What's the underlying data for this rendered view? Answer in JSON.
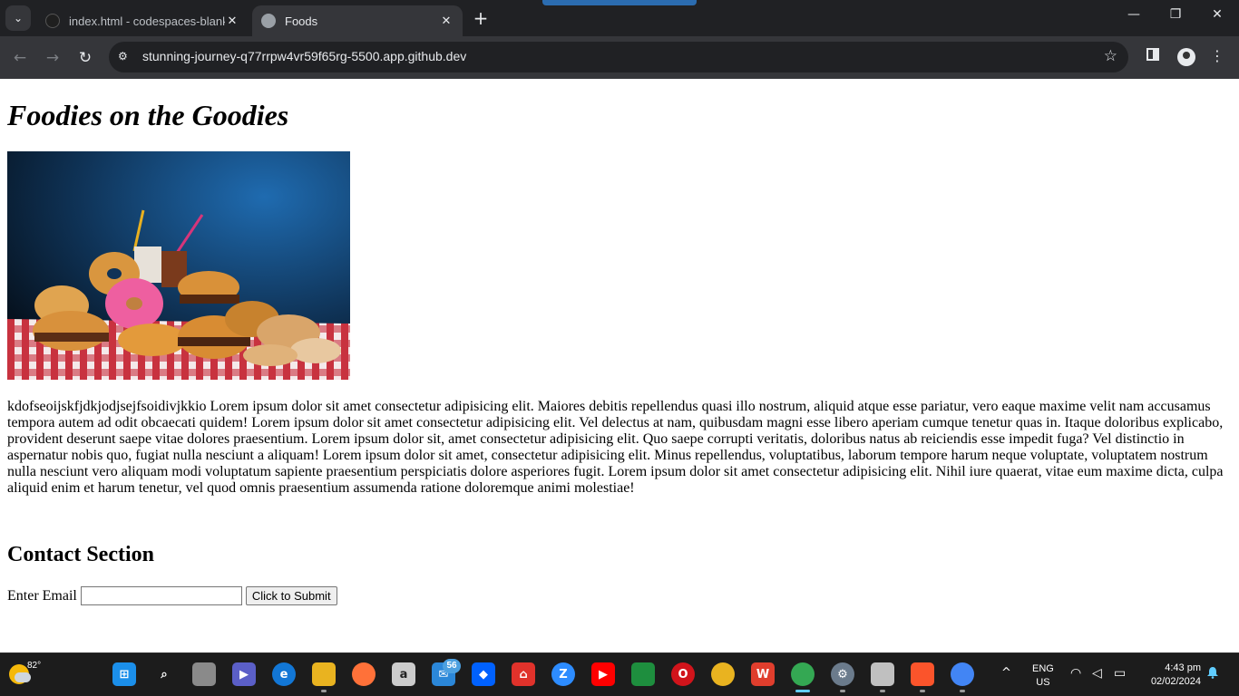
{
  "browser": {
    "tabs": [
      {
        "title": "index.html - codespaces-blank [",
        "active": false
      },
      {
        "title": "Foods",
        "active": true
      }
    ],
    "url": "stunning-journey-q77rrpw4vr59f65rg-5500.app.github.dev"
  },
  "page": {
    "heading": "Foodies on the Goodies",
    "paragraph": "kdofseoijskfjdkjodjsejfsoidivjkkio Lorem ipsum dolor sit amet consectetur adipisicing elit. Maiores debitis repellendus quasi illo nostrum, aliquid atque esse pariatur, vero eaque maxime velit nam accusamus tempora autem ad odit obcaecati quidem! Lorem ipsum dolor sit amet consectetur adipisicing elit. Vel delectus at nam, quibusdam magni esse libero aperiam cumque tenetur quas in. Itaque doloribus explicabo, provident deserunt saepe vitae dolores praesentium. Lorem ipsum dolor sit, amet consectetur adipisicing elit. Quo saepe corrupti veritatis, doloribus natus ab reiciendis esse impedit fuga? Vel distinctio in aspernatur nobis quo, fugiat nulla nesciunt a aliquam! Lorem ipsum dolor sit amet, consectetur adipisicing elit. Minus repellendus, voluptatibus, laborum tempore harum neque voluptate, voluptatem nostrum nulla nesciunt vero aliquam modi voluptatum sapiente praesentium perspiciatis dolore asperiores fugit. Lorem ipsum dolor sit amet consectetur adipisicing elit. Nihil iure quaerat, vitae eum maxime dicta, culpa aliquid enim et harum tenetur, vel quod omnis praesentium assumenda ratione doloremque animi molestiae!",
    "contact_heading": "Contact Section",
    "email_label": "Enter Email",
    "email_value": "",
    "submit_label": "Click to Submit"
  },
  "taskbar": {
    "weather_temp": "82°",
    "mail_badge": "56",
    "lang_line1": "ENG",
    "lang_line2": "US",
    "time": "4:43 pm",
    "date": "02/02/2024"
  }
}
